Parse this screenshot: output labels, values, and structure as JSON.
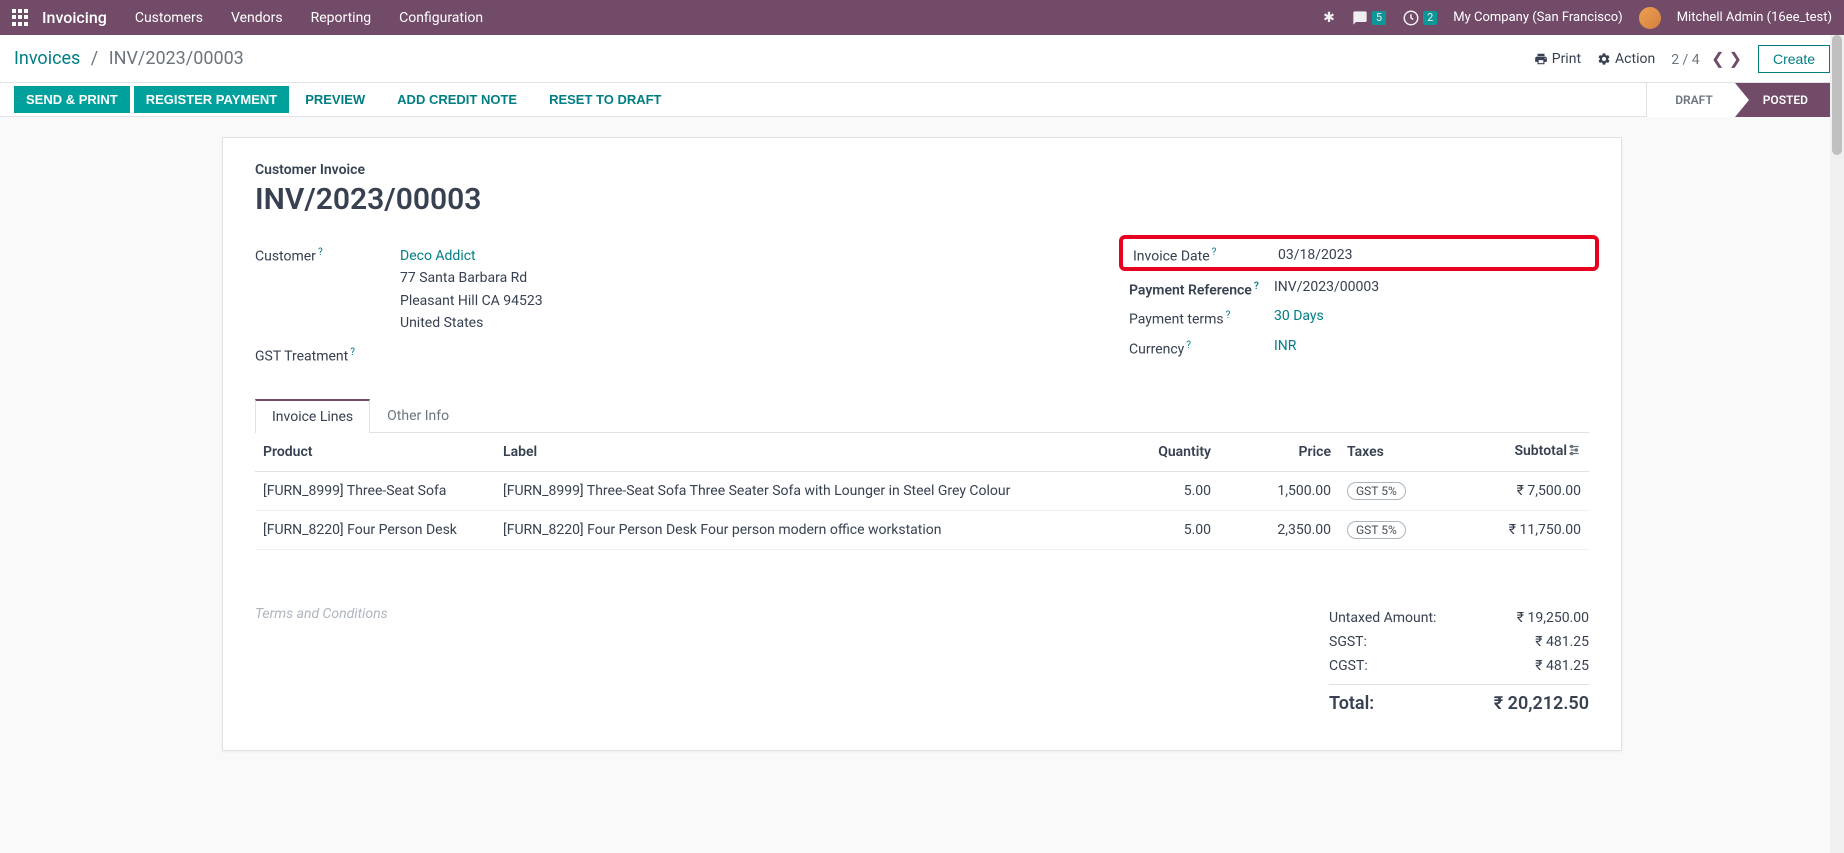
{
  "nav": {
    "app": "Invoicing",
    "menu": [
      "Customers",
      "Vendors",
      "Reporting",
      "Configuration"
    ],
    "msg_badge": "5",
    "clock_badge": "2",
    "company": "My Company (San Francisco)",
    "user": "Mitchell Admin (16ee_test)"
  },
  "controlbar": {
    "root": "Invoices",
    "current": "INV/2023/00003",
    "print": "Print",
    "action": "Action",
    "pager": "2 / 4",
    "create": "Create"
  },
  "actions": {
    "send_print": "SEND & PRINT",
    "register": "REGISTER PAYMENT",
    "preview": "PREVIEW",
    "credit": "ADD CREDIT NOTE",
    "reset": "RESET TO DRAFT",
    "draft": "DRAFT",
    "posted": "POSTED"
  },
  "doc": {
    "title_label": "Customer Invoice",
    "title": "INV/2023/00003",
    "customer_label": "Customer",
    "customer_name": "Deco Addict",
    "addr1": "77 Santa Barbara Rd",
    "addr2": "Pleasant Hill CA 94523",
    "addr3": "United States",
    "gst_label": "GST Treatment",
    "invoice_date_label": "Invoice Date",
    "invoice_date": "03/18/2023",
    "payref_label": "Payment Reference",
    "payref": "INV/2023/00003",
    "terms_label": "Payment terms",
    "terms": "30 Days",
    "currency_label": "Currency",
    "currency": "INR"
  },
  "tabs": {
    "lines": "Invoice Lines",
    "other": "Other Info"
  },
  "table": {
    "h_product": "Product",
    "h_label": "Label",
    "h_qty": "Quantity",
    "h_price": "Price",
    "h_taxes": "Taxes",
    "h_subtotal": "Subtotal",
    "rows": [
      {
        "product": "[FURN_8999] Three-Seat Sofa",
        "label": "[FURN_8999] Three-Seat Sofa Three Seater Sofa with Lounger in Steel Grey Colour",
        "qty": "5.00",
        "price": "1,500.00",
        "tax": "GST 5%",
        "subtotal": "₹ 7,500.00"
      },
      {
        "product": "[FURN_8220] Four Person Desk",
        "label": "[FURN_8220] Four Person Desk Four person modern office workstation",
        "qty": "5.00",
        "price": "2,350.00",
        "tax": "GST 5%",
        "subtotal": "₹ 11,750.00"
      }
    ]
  },
  "footer": {
    "terms_placeholder": "Terms and Conditions",
    "untaxed_l": "Untaxed Amount:",
    "untaxed_v": "₹ 19,250.00",
    "sgst_l": "SGST:",
    "sgst_v": "₹ 481.25",
    "cgst_l": "CGST:",
    "cgst_v": "₹ 481.25",
    "total_l": "Total:",
    "total_v": "₹ 20,212.50"
  }
}
